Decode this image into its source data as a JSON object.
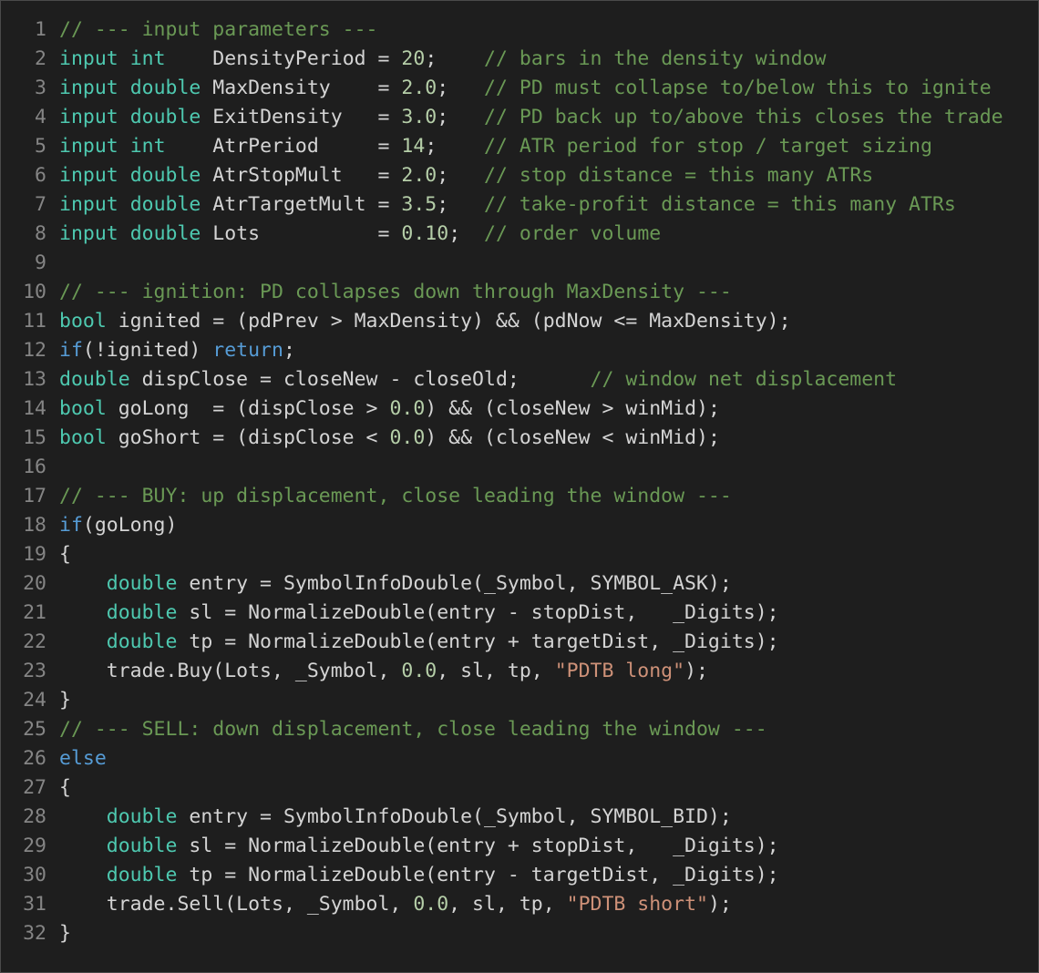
{
  "colors": {
    "background": "#1e1e1e",
    "line_number": "#858585",
    "plain": "#d4d4d4",
    "comment": "#6a9955",
    "type_keyword": "#4ec9b0",
    "control_keyword": "#569cd6",
    "number": "#b5cea8",
    "string": "#ce9178"
  },
  "lines": [
    {
      "n": "1",
      "tokens": [
        [
          "c",
          "// --- input parameters ---"
        ]
      ]
    },
    {
      "n": "2",
      "tokens": [
        [
          "k",
          "input"
        ],
        [
          "p",
          " "
        ],
        [
          "k",
          "int"
        ],
        [
          "p",
          "    DensityPeriod = "
        ],
        [
          "n",
          "20"
        ],
        [
          "p",
          ";    "
        ],
        [
          "c",
          "// bars in the density window"
        ]
      ]
    },
    {
      "n": "3",
      "tokens": [
        [
          "k",
          "input"
        ],
        [
          "p",
          " "
        ],
        [
          "k",
          "double"
        ],
        [
          "p",
          " MaxDensity    = "
        ],
        [
          "n",
          "2.0"
        ],
        [
          "p",
          ";   "
        ],
        [
          "c",
          "// PD must collapse to/below this to ignite"
        ]
      ]
    },
    {
      "n": "4",
      "tokens": [
        [
          "k",
          "input"
        ],
        [
          "p",
          " "
        ],
        [
          "k",
          "double"
        ],
        [
          "p",
          " ExitDensity   = "
        ],
        [
          "n",
          "3.0"
        ],
        [
          "p",
          ";   "
        ],
        [
          "c",
          "// PD back up to/above this closes the trade"
        ]
      ]
    },
    {
      "n": "5",
      "tokens": [
        [
          "k",
          "input"
        ],
        [
          "p",
          " "
        ],
        [
          "k",
          "int"
        ],
        [
          "p",
          "    AtrPeriod     = "
        ],
        [
          "n",
          "14"
        ],
        [
          "p",
          ";    "
        ],
        [
          "c",
          "// ATR period for stop / target sizing"
        ]
      ]
    },
    {
      "n": "6",
      "tokens": [
        [
          "k",
          "input"
        ],
        [
          "p",
          " "
        ],
        [
          "k",
          "double"
        ],
        [
          "p",
          " AtrStopMult   = "
        ],
        [
          "n",
          "2.0"
        ],
        [
          "p",
          ";   "
        ],
        [
          "c",
          "// stop distance = this many ATRs"
        ]
      ]
    },
    {
      "n": "7",
      "tokens": [
        [
          "k",
          "input"
        ],
        [
          "p",
          " "
        ],
        [
          "k",
          "double"
        ],
        [
          "p",
          " AtrTargetMult = "
        ],
        [
          "n",
          "3.5"
        ],
        [
          "p",
          ";   "
        ],
        [
          "c",
          "// take-profit distance = this many ATRs"
        ]
      ]
    },
    {
      "n": "8",
      "tokens": [
        [
          "k",
          "input"
        ],
        [
          "p",
          " "
        ],
        [
          "k",
          "double"
        ],
        [
          "p",
          " Lots          = "
        ],
        [
          "n",
          "0.10"
        ],
        [
          "p",
          ";  "
        ],
        [
          "c",
          "// order volume"
        ]
      ]
    },
    {
      "n": "9",
      "tokens": []
    },
    {
      "n": "10",
      "tokens": [
        [
          "c",
          "// --- ignition: PD collapses down through MaxDensity ---"
        ]
      ]
    },
    {
      "n": "11",
      "tokens": [
        [
          "k",
          "bool"
        ],
        [
          "p",
          " ignited = (pdPrev > MaxDensity) && (pdNow <= MaxDensity);"
        ]
      ]
    },
    {
      "n": "12",
      "tokens": [
        [
          "kw",
          "if"
        ],
        [
          "p",
          "(!ignited) "
        ],
        [
          "kw",
          "return"
        ],
        [
          "p",
          ";"
        ]
      ]
    },
    {
      "n": "13",
      "tokens": [
        [
          "k",
          "double"
        ],
        [
          "p",
          " dispClose = closeNew - closeOld;      "
        ],
        [
          "c",
          "// window net displacement"
        ]
      ]
    },
    {
      "n": "14",
      "tokens": [
        [
          "k",
          "bool"
        ],
        [
          "p",
          " goLong  = (dispClose > "
        ],
        [
          "n",
          "0.0"
        ],
        [
          "p",
          ") && (closeNew > winMid);"
        ]
      ]
    },
    {
      "n": "15",
      "tokens": [
        [
          "k",
          "bool"
        ],
        [
          "p",
          " goShort = (dispClose < "
        ],
        [
          "n",
          "0.0"
        ],
        [
          "p",
          ") && (closeNew < winMid);"
        ]
      ]
    },
    {
      "n": "16",
      "tokens": []
    },
    {
      "n": "17",
      "tokens": [
        [
          "c",
          "// --- BUY: up displacement, close leading the window ---"
        ]
      ]
    },
    {
      "n": "18",
      "tokens": [
        [
          "kw",
          "if"
        ],
        [
          "p",
          "(goLong)"
        ]
      ]
    },
    {
      "n": "19",
      "tokens": [
        [
          "p",
          "{"
        ]
      ]
    },
    {
      "n": "20",
      "tokens": [
        [
          "p",
          "    "
        ],
        [
          "k",
          "double"
        ],
        [
          "p",
          " entry = SymbolInfoDouble(_Symbol, SYMBOL_ASK);"
        ]
      ]
    },
    {
      "n": "21",
      "tokens": [
        [
          "p",
          "    "
        ],
        [
          "k",
          "double"
        ],
        [
          "p",
          " sl = NormalizeDouble(entry - stopDist,   _Digits);"
        ]
      ]
    },
    {
      "n": "22",
      "tokens": [
        [
          "p",
          "    "
        ],
        [
          "k",
          "double"
        ],
        [
          "p",
          " tp = NormalizeDouble(entry + targetDist, _Digits);"
        ]
      ]
    },
    {
      "n": "23",
      "tokens": [
        [
          "p",
          "    trade.Buy(Lots, _Symbol, "
        ],
        [
          "n",
          "0.0"
        ],
        [
          "p",
          ", sl, tp, "
        ],
        [
          "s",
          "\"PDTB long\""
        ],
        [
          "p",
          ");"
        ]
      ]
    },
    {
      "n": "24",
      "tokens": [
        [
          "p",
          "}"
        ]
      ]
    },
    {
      "n": "25",
      "tokens": [
        [
          "c",
          "// --- SELL: down displacement, close leading the window ---"
        ]
      ]
    },
    {
      "n": "26",
      "tokens": [
        [
          "kw",
          "else"
        ]
      ]
    },
    {
      "n": "27",
      "tokens": [
        [
          "p",
          "{"
        ]
      ]
    },
    {
      "n": "28",
      "tokens": [
        [
          "p",
          "    "
        ],
        [
          "k",
          "double"
        ],
        [
          "p",
          " entry = SymbolInfoDouble(_Symbol, SYMBOL_BID);"
        ]
      ]
    },
    {
      "n": "29",
      "tokens": [
        [
          "p",
          "    "
        ],
        [
          "k",
          "double"
        ],
        [
          "p",
          " sl = NormalizeDouble(entry + stopDist,   _Digits);"
        ]
      ]
    },
    {
      "n": "30",
      "tokens": [
        [
          "p",
          "    "
        ],
        [
          "k",
          "double"
        ],
        [
          "p",
          " tp = NormalizeDouble(entry - targetDist, _Digits);"
        ]
      ]
    },
    {
      "n": "31",
      "tokens": [
        [
          "p",
          "    trade.Sell(Lots, _Symbol, "
        ],
        [
          "n",
          "0.0"
        ],
        [
          "p",
          ", sl, tp, "
        ],
        [
          "s",
          "\"PDTB short\""
        ],
        [
          "p",
          ");"
        ]
      ]
    },
    {
      "n": "32",
      "tokens": [
        [
          "p",
          "}"
        ]
      ]
    }
  ]
}
